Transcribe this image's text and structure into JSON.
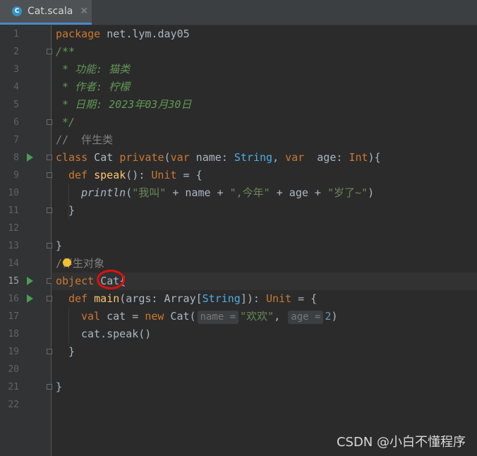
{
  "tab": {
    "icon_letter": "C",
    "label": "Cat.scala",
    "close": "✕"
  },
  "line_numbers": [
    "1",
    "2",
    "3",
    "4",
    "5",
    "6",
    "7",
    "8",
    "9",
    "10",
    "11",
    "12",
    "13",
    "14",
    "15",
    "16",
    "17",
    "18",
    "19",
    "20",
    "21",
    "22"
  ],
  "code": {
    "l1": {
      "kw": "package",
      "rest": " net.lym.day05"
    },
    "l2": "/**",
    "l3": " * 功能: 猫类",
    "l4": " * 作者: 柠檬",
    "l5": " * 日期: 2023年03月30日",
    "l6": " */",
    "l7": "//  伴生类",
    "l8": {
      "k1": "class",
      "t1": " Cat ",
      "k2": "private",
      "t2": "(",
      "k3": "var",
      "t3": " name: ",
      "ty1": "String",
      "t4": ", ",
      "k4": "var",
      "t5": "  age: ",
      "ty2": "Int",
      "t6": "){"
    },
    "l9": {
      "k1": "def",
      "f1": " speak",
      "t1": "(): ",
      "ty1": "Unit",
      "t2": " = {"
    },
    "l10": {
      "f1": "println",
      "t1": "(",
      "s1": "\"我叫\"",
      "t2": " + name + ",
      "s2": "\",今年\"",
      "t3": " + age + ",
      "s3": "\"岁了~\"",
      "t4": ")"
    },
    "l11": "}",
    "l13": "}",
    "l14": "/伴生对象",
    "l15": {
      "k1": "object",
      "t1": " Cat{"
    },
    "l16": {
      "k1": "def",
      "f1": " main",
      "t1": "(args: Array[",
      "ty1": "String",
      "t2": "]): ",
      "ty2": "Unit",
      "t3": " = {"
    },
    "l17": {
      "k1": "val",
      "t1": " cat = ",
      "k2": "new",
      "t2": " Cat(",
      "h1": "name =",
      "s1": "\"欢欢\"",
      "t3": ", ",
      "h2": "age =",
      "n1": "2",
      "t4": ")"
    },
    "l18": "cat.speak()",
    "l19": "}",
    "l21": "}"
  },
  "watermark": "CSDN @小白不懂程序",
  "colors": {
    "background": "#2b2b2b",
    "keyword": "#cc7832",
    "string": "#6a8759",
    "doc_comment": "#629755",
    "run_icon": "#499c54",
    "annotation": "#e01010"
  }
}
